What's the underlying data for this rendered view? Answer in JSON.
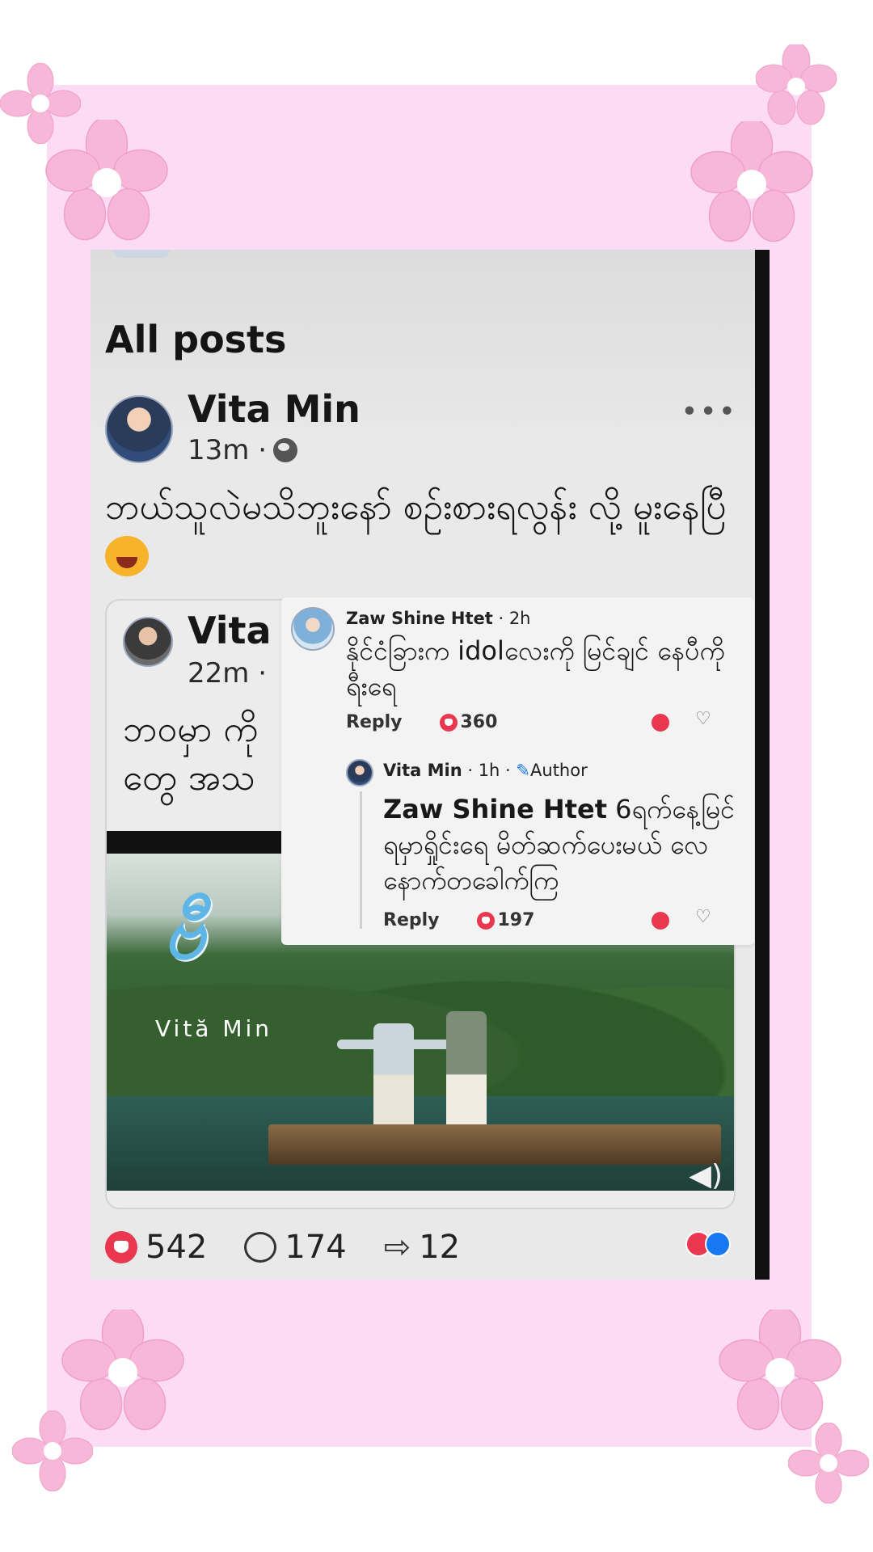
{
  "feed": {
    "section_title": "All posts"
  },
  "post": {
    "author": "Vita Min",
    "time": "13m ·",
    "text": "ဘယ်သူလဲမသိဘူးနော် စဉ်းစားရလွန်း လို့ မူးနေပြီ",
    "more_icon": "more-dots-icon",
    "stats": {
      "likes": "542",
      "comments": "174",
      "shares": "12"
    }
  },
  "shared_post": {
    "author": "Vita M",
    "time": "22m · ",
    "text_line1": "ဘဝမှာ ကို",
    "text_line2": "တွေ အသ",
    "video_logo_text": "Vită Min"
  },
  "comments": [
    {
      "author": "Zaw Shine Htet",
      "time": "· 2h",
      "text": "နိုင်ငံခြားက idolလေးကို မြင်ချင် နေပီကိုရီးရေ",
      "reply_label": "Reply",
      "reaction_count": "360"
    },
    {
      "author": "Vita Min",
      "time": "· 1h ·",
      "badge": "Author",
      "mention": "Zaw Shine Htet",
      "text": "6ရက်နေ့မြင် ရမှာရှိုင်းရေ မိတ်ဆက်ပေးမယ် လေ နောက်တခေါက်ကြ",
      "reply_label": "Reply",
      "reaction_count": "197"
    }
  ],
  "colors": {
    "frame": "#fcdcf5",
    "flower": "#f7b7d8",
    "love": "#e8374e",
    "like": "#1877f2"
  }
}
